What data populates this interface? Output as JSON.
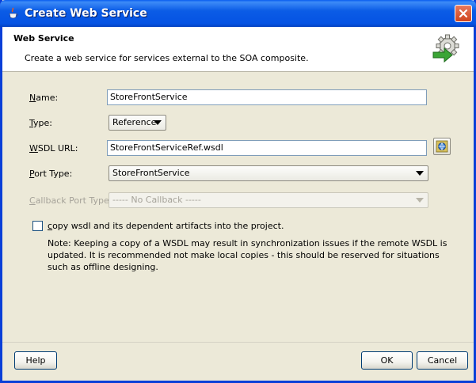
{
  "window": {
    "title": "Create Web Service"
  },
  "header": {
    "title": "Web Service",
    "subtitle": "Create a web service for services external to the SOA composite."
  },
  "form": {
    "name": {
      "label_mnemonic": "N",
      "label_rest": "ame:",
      "value": "StoreFrontService"
    },
    "type": {
      "label_mnemonic": "T",
      "label_rest": "ype:",
      "value": "Reference"
    },
    "wsdl_url": {
      "label_mnemonic": "W",
      "label_rest": "SDL URL:",
      "value": "StoreFrontServiceRef.wsdl"
    },
    "port_type": {
      "label_mnemonic": "P",
      "label_rest": "ort Type:",
      "value": "StoreFrontService"
    },
    "callback_port_type": {
      "label_mnemonic": "C",
      "label_rest": "allback Port Type:",
      "value": "----- No Callback -----",
      "disabled": true
    }
  },
  "copy_option": {
    "label_mnemonic": "c",
    "label_rest": "opy wsdl and its dependent artifacts into the project.",
    "checked": false,
    "note": "Note: Keeping a copy of a WSDL may result in synchronization issues if the remote WSDL is updated. It is recommended not make local copies - this should be reserved for situations such as offline designing."
  },
  "buttons": {
    "help": "Help",
    "ok": "OK",
    "cancel": "Cancel"
  },
  "icons": {
    "title": "java-cup-icon",
    "header": "gear-arrow-icon",
    "browse": "wsdl-browse-icon",
    "close": "close-icon"
  },
  "colors": {
    "titlebar": "#0553e3",
    "dialog_bg": "#ece9d8",
    "close_button": "#d0441c"
  }
}
